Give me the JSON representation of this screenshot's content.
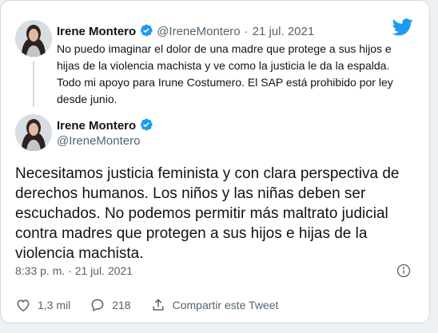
{
  "quoted": {
    "name": "Irene Montero",
    "handle": "@IreneMontero",
    "separator": "·",
    "date": "21 jul. 2021",
    "text": "No puedo imaginar el dolor de una madre que protege a sus hijos e hijas de la violencia machista y ve como la justicia le da la espalda. Todo mi apoyo para Irune Costumero. El SAP está prohibido por ley desde junio."
  },
  "main": {
    "name": "Irene Montero",
    "handle": "@IreneMontero",
    "text": "Necesitamos justicia feminista y con clara perspectiva de derechos humanos. Los niños y las niñas deben ser escuchados. No podemos permitir más maltrato judicial contra madres que protegen a sus hijos e hijas de la violencia machista.",
    "timestamp": "8:33 p. m. · 21 jul. 2021"
  },
  "actions": {
    "likes": "1,3 mil",
    "replies": "218",
    "share_label": "Compartir este Tweet"
  },
  "icons": {
    "brand": "twitter-bird-icon",
    "verified": "verified-badge-icon",
    "info": "info-icon",
    "like": "heart-icon",
    "reply": "reply-icon",
    "share": "share-icon"
  },
  "colors": {
    "brand_blue": "#1d9bf0",
    "text_primary": "#0f1419",
    "text_secondary": "#536471",
    "border": "#cfd9de"
  }
}
